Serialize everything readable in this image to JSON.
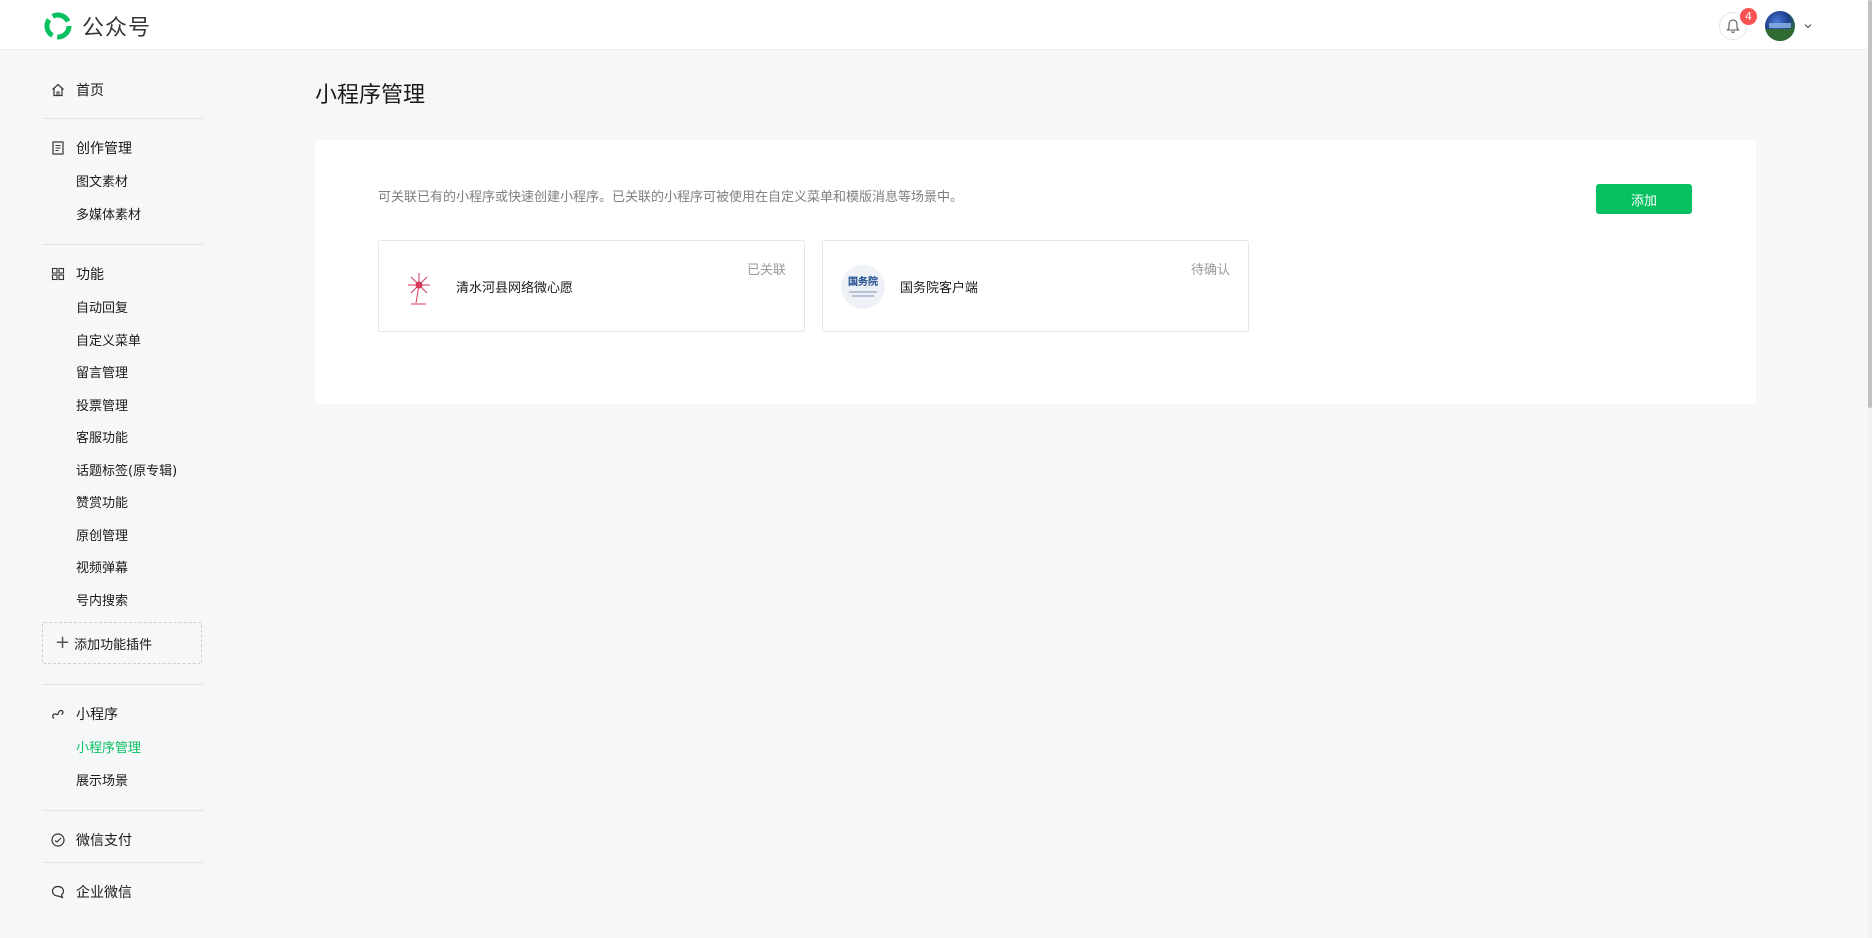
{
  "header": {
    "app_title": "公众号",
    "notification_count": "4",
    "brand_color": "#07c160"
  },
  "sidebar": {
    "home": {
      "label": "首页",
      "icon": "home-icon"
    },
    "creation": {
      "label": "创作管理",
      "icon": "document-icon",
      "items": [
        "图文素材",
        "多媒体素材"
      ]
    },
    "features": {
      "label": "功能",
      "icon": "grid-icon",
      "items": [
        "自动回复",
        "自定义菜单",
        "留言管理",
        "投票管理",
        "客服功能",
        "话题标签(原专辑)",
        "赞赏功能",
        "原创管理",
        "视频弹幕",
        "号内搜索"
      ],
      "add_plugin_label": "添加功能插件"
    },
    "miniprogram": {
      "label": "小程序",
      "icon": "link-icon",
      "items": [
        "小程序管理",
        "展示场景"
      ],
      "active_item": "小程序管理"
    },
    "wechat_pay": {
      "label": "微信支付",
      "icon": "wechat-pay-icon"
    },
    "work_wechat": {
      "label": "企业微信",
      "icon": "chat-bubble-icon"
    }
  },
  "main": {
    "page_title": "小程序管理",
    "description": "可关联已有的小程序或快速创建小程序。已关联的小程序可被使用在自定义菜单和模版消息等场景中。",
    "add_button_label": "添加",
    "cards": [
      {
        "name": "清水河县网络微心愿",
        "status": "已关联",
        "logo": "dandelion-logo"
      },
      {
        "name": "国务院客户端",
        "status": "待确认",
        "logo": "gov-logo",
        "logo_text": "国务院"
      }
    ]
  }
}
